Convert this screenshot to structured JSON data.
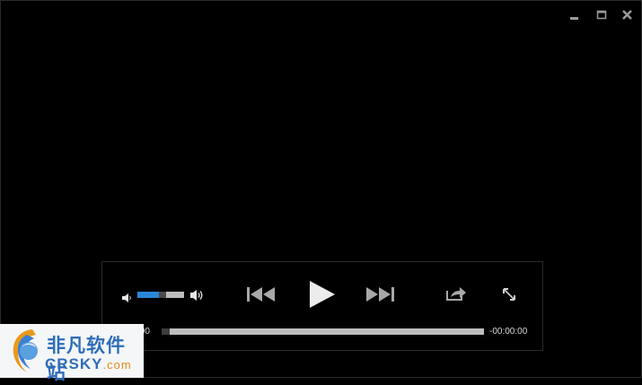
{
  "window": {
    "minimize_icon": "minimize-icon",
    "maximize_icon": "maximize-icon",
    "close_icon": "close-icon"
  },
  "player": {
    "volume": 0.55,
    "progress": 0.0,
    "current_time": "00:00:00",
    "remaining_time": "-00:00:00",
    "icons": [
      "volume-low-icon",
      "volume-high-icon",
      "skip-previous-icon",
      "play-icon",
      "skip-next-icon",
      "share-icon",
      "fullscreen-icon"
    ]
  },
  "watermark": {
    "title": "非凡软件站",
    "brand": "CRSKY",
    "domain": ".com"
  },
  "colors": {
    "background": "#000000",
    "volume_fill": "#2b86d8",
    "track": "#bdbdbd",
    "watermark_text": "#2d6db8"
  }
}
